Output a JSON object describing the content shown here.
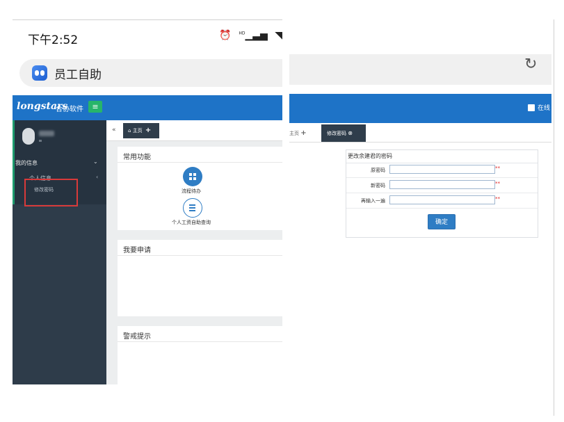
{
  "phone": {
    "time": "下午2:52",
    "icons": [
      "alarm-icon",
      "signal-icon",
      "wifi-icon"
    ],
    "status_hd": "HD"
  },
  "app": {
    "title": "员工自助"
  },
  "left": {
    "brand": "longstars",
    "brand_sub": "合协软件",
    "menu_glyph": "≡",
    "sidebar": {
      "user_sub": "-",
      "my_info": "我的信息",
      "personal_info": "个人信息",
      "change_password": "修改密码"
    },
    "tabs": {
      "back": "«",
      "home": "主页"
    },
    "cards": {
      "common": "常用功能",
      "apply": "我要申请",
      "alert": "警戒提示"
    },
    "functions": [
      {
        "label": "流程待办",
        "icon": "grid-icon"
      },
      {
        "label": "个人工资自助查询",
        "icon": "list-icon"
      }
    ]
  },
  "right": {
    "online": "在线",
    "tabs": {
      "home": "主页",
      "active": "修改密码"
    },
    "form": {
      "title": "更改余建君的密码",
      "fields": [
        {
          "label": "原密码",
          "value": "",
          "required": "**"
        },
        {
          "label": "新密码",
          "value": "",
          "required": "**"
        },
        {
          "label": "再输入一遍",
          "value": "",
          "required": "**"
        }
      ],
      "submit": "确定"
    }
  },
  "colors": {
    "nav_blue": "#1e73c7",
    "sidebar_dark": "#2e3c4a",
    "tab_dark": "#2f3d4b",
    "menu_green": "#27b56a",
    "highlight_red": "#d93a3a",
    "button_blue": "#2f7dc4"
  }
}
